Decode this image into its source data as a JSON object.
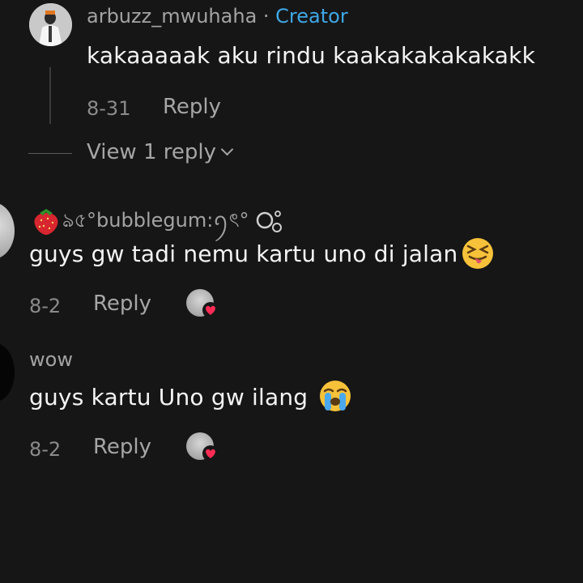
{
  "comments": [
    {
      "username": "arbuzz_mwuhaha",
      "separator": " · ",
      "badge": "Creator",
      "text": "kakaaaaak aku rindu kaakakakakakakk",
      "date": "8-31",
      "reply_label": "Reply",
      "view_replies": "View 1 reply",
      "avatar_icon": "creator-avatar"
    },
    {
      "username_prefix_emoji": "strawberry",
      "username": "ঌ৫°bubblegum:ꪆৎ°",
      "text": "guys gw tadi nemu kartu uno di jalan",
      "text_emoji": "squinting-face-with-tongue",
      "date": "8-2",
      "reply_label": "Reply",
      "liked_by_creator": true
    },
    {
      "username": "wow",
      "text": "guys kartu Uno gw ilang",
      "text_emoji": "loudly-crying-face",
      "date": "8-2",
      "reply_label": "Reply",
      "liked_by_creator": true
    }
  ],
  "colors": {
    "background": "#161616",
    "creator_badge": "#3fa8e6",
    "muted_text": "#a6a6a6",
    "heart": "#fe2c55"
  }
}
